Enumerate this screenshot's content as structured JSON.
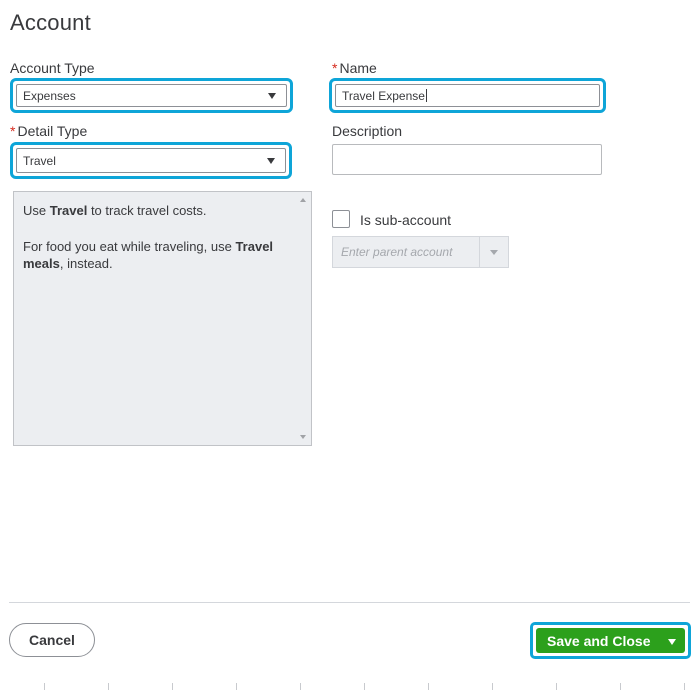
{
  "title": "Account",
  "account_type": {
    "label": "Account Type",
    "value": "Expenses"
  },
  "name": {
    "required_mark": "*",
    "label": "Name",
    "value": "Travel Expense"
  },
  "detail_type": {
    "required_mark": "*",
    "label": "Detail Type",
    "value": "Travel"
  },
  "description": {
    "label": "Description",
    "value": ""
  },
  "detail_description": {
    "line1_prefix": "Use ",
    "line1_bold": "Travel",
    "line1_suffix": " to track travel costs.",
    "line2_prefix": "For food you eat while traveling, use ",
    "line2_bold": "Travel meals",
    "line2_suffix": ", instead."
  },
  "sub_account": {
    "label": "Is sub-account",
    "checked": false,
    "parent_placeholder": "Enter parent account"
  },
  "footer": {
    "cancel_label": "Cancel",
    "save_label": "Save and Close"
  },
  "colors": {
    "focus": "#0ea5d8",
    "primary_green": "#2ca01c",
    "required": "#d52b1e"
  }
}
